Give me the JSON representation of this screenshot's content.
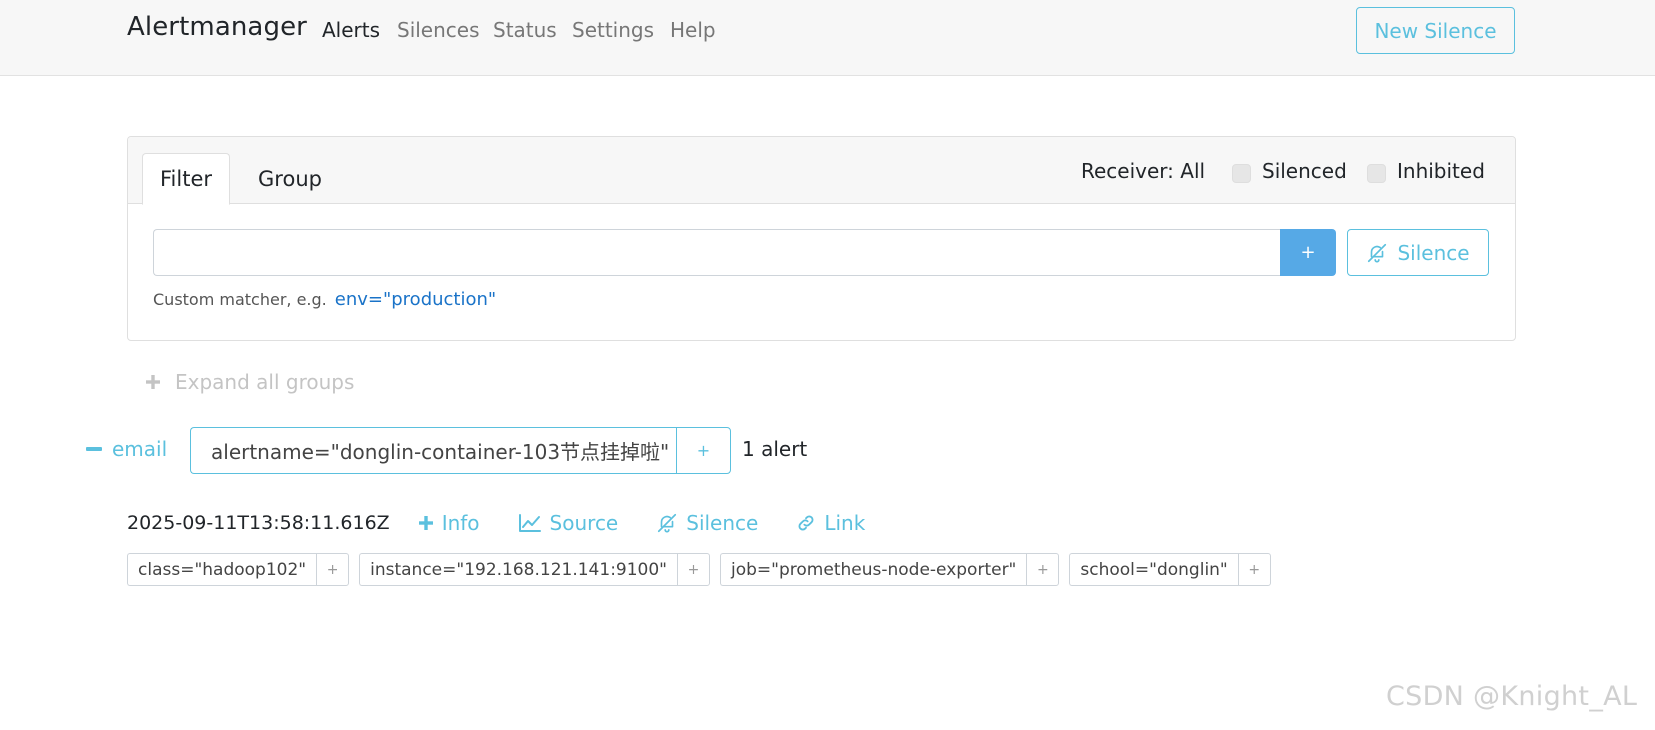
{
  "nav": {
    "brand": "Alertmanager",
    "links": [
      "Alerts",
      "Silences",
      "Status",
      "Settings",
      "Help"
    ],
    "new_silence": "New Silence"
  },
  "filter_card": {
    "tabs": [
      "Filter",
      "Group"
    ],
    "receiver": "Receiver: All",
    "silenced": "Silenced",
    "inhibited": "Inhibited",
    "input_value": "",
    "plus": "+",
    "silence_button": "Silence",
    "hint": "Custom matcher, e.g.",
    "hint_example": "env=\"production\""
  },
  "expand_all": "Expand all groups",
  "group": {
    "receiver": "email",
    "label": "alertname=\"donglin-container-103节点挂掉啦\"",
    "plus": "+",
    "count": "1 alert"
  },
  "alert": {
    "timestamp": "2025-09-11T13:58:11.616Z",
    "actions": [
      "Info",
      "Source",
      "Silence",
      "Link"
    ],
    "labels": [
      "class=\"hadoop102\"",
      "instance=\"192.168.121.141:9100\"",
      "job=\"prometheus-node-exporter\"",
      "school=\"donglin\""
    ],
    "label_plus": "+"
  },
  "watermark": "CSDN @Knight_AL",
  "colors": {
    "accent": "#5bc0de",
    "primary_button": "#56a9e6",
    "navbar_bg": "#f7f7f7",
    "link": "#1a73c8"
  }
}
